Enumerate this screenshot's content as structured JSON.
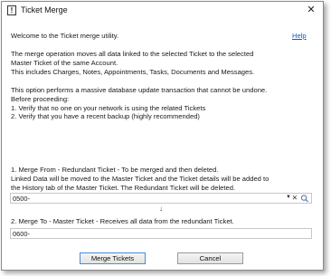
{
  "window": {
    "title": "Ticket Merge"
  },
  "help_link": "Help",
  "intro": {
    "welcome": "Welcome to the Ticket merge utility.",
    "p1": [
      "The merge operation moves all data linked to the selected Ticket to the selected",
      "Master Ticket of the same Account.",
      "This includes Charges, Notes, Appointments, Tasks, Documents and Messages."
    ],
    "p2": [
      "This option performs a massive database update transaction that cannot be undone.",
      "Before proceeding:",
      "1. Verify that no one on your network is using the related Tickets",
      "2. Verify that you have a recent backup (highly recommended)"
    ]
  },
  "merge_from": {
    "lines": [
      "1. Merge From - Redundant Ticket - To be merged and then deleted.",
      "Linked Data will be moved to the Master Ticket and the Ticket details will be added to",
      "the History tab of the Master Ticket. The Redundant Ticket will be deleted."
    ],
    "value": "0500-"
  },
  "merge_to": {
    "label": "2. Merge To - Master Ticket - Receives all data from the redundant Ticket.",
    "value": "0600-"
  },
  "buttons": {
    "merge": "Merge Tickets",
    "cancel": "Cancel"
  },
  "icons": {
    "app": "info-window-icon",
    "close": "close-icon",
    "dropdown": "chevron-down-icon",
    "clear": "clear-icon",
    "search": "search-icon",
    "arrow": "arrow-down-icon"
  }
}
